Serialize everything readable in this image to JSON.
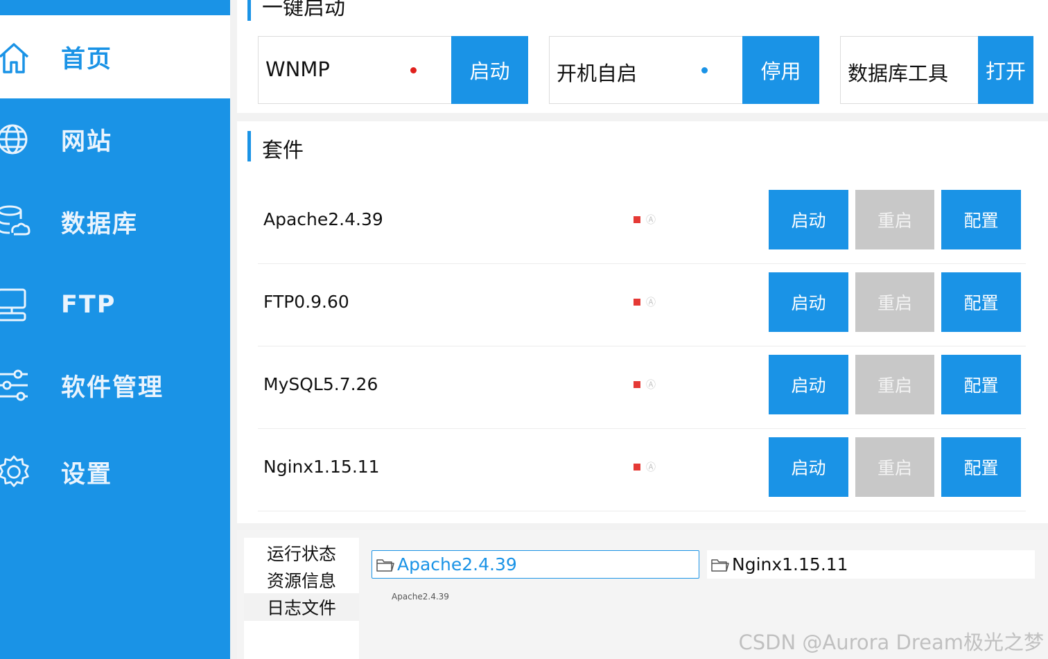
{
  "sidebar": {
    "items": [
      {
        "label": "首页",
        "icon": "home-icon",
        "active": true
      },
      {
        "label": "网站",
        "icon": "globe-icon",
        "active": false
      },
      {
        "label": "数据库",
        "icon": "database-icon",
        "active": false
      },
      {
        "label": "FTP",
        "icon": "server-icon",
        "active": false
      },
      {
        "label": "软件管理",
        "icon": "sliders-icon",
        "active": false
      },
      {
        "label": "设置",
        "icon": "gear-icon",
        "active": false
      }
    ]
  },
  "quick_start": {
    "title": "一键启动",
    "items": [
      {
        "label": "WNMP",
        "status": "stopped",
        "status_color": "#e0201c",
        "button": "启动"
      },
      {
        "label": "开机自启",
        "status": "enabled",
        "status_color": "#1a93e6",
        "button": "停用"
      },
      {
        "label": "数据库工具",
        "button": "打开"
      }
    ]
  },
  "suite": {
    "title": "套件",
    "rows": [
      {
        "name": "Apache2.4.39",
        "status": "stopped",
        "glyph": "Ⓐ",
        "start": "启动",
        "restart": "重启",
        "config": "配置"
      },
      {
        "name": "FTP0.9.60",
        "status": "stopped",
        "glyph": "Ⓐ",
        "start": "启动",
        "restart": "重启",
        "config": "配置"
      },
      {
        "name": "MySQL5.7.26",
        "status": "stopped",
        "glyph": "Ⓐ",
        "start": "启动",
        "restart": "重启",
        "config": "配置"
      },
      {
        "name": "Nginx1.15.11",
        "status": "stopped",
        "glyph": "Ⓐ",
        "start": "启动",
        "restart": "重启",
        "config": "配置"
      }
    ]
  },
  "bottom": {
    "tabs": [
      {
        "label": "运行状态",
        "active": false
      },
      {
        "label": "资源信息",
        "active": false
      },
      {
        "label": "日志文件",
        "active": true
      }
    ],
    "file_tabs": [
      {
        "label": "Apache2.4.39",
        "icon": "folder-icon",
        "selected": true
      },
      {
        "label": "Nginx1.15.11",
        "icon": "folder-icon",
        "selected": false
      }
    ],
    "log_content": "Apache2.4.39"
  },
  "watermark": "CSDN @Aurora Dream极光之梦",
  "colors": {
    "accent": "#1a93e6",
    "status_red": "#e53935",
    "button_gray": "#c8c8c8"
  }
}
